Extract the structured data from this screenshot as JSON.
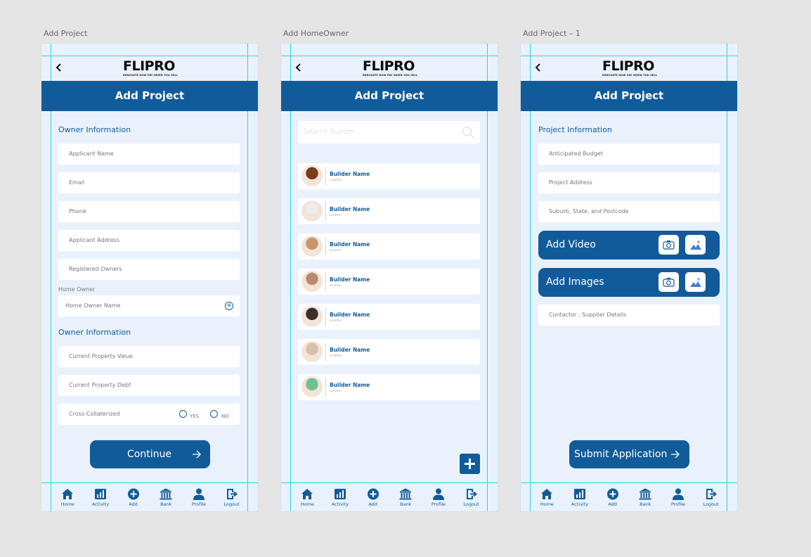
{
  "screens": [
    {
      "artboard_label": "Add Project",
      "logo": {
        "text": "FLIPRO",
        "tagline": "RENOVATE NOW PAY WHEN YOU SELL"
      },
      "header": {
        "title": "Add Project"
      },
      "sections": {
        "owner_info_1": "Owner Information",
        "home_owner_label": "Home Owner",
        "owner_info_2": "Owner Information"
      },
      "fields": {
        "applicant_name": "Applicant Name",
        "email": "Email",
        "phone": "Phone",
        "applicant_address": "Applicant Address",
        "registered_owners": "Registered Owners",
        "home_owner_name": "Home Owner Name",
        "current_property_value": "Current Property Value",
        "current_property_debt": "Current Property Debt",
        "cross_collateralized": "Cross-Collaterized"
      },
      "radio": {
        "yes": "YES",
        "no": "NO"
      },
      "continue_button": "Continue"
    },
    {
      "artboard_label": "Add HomeOwner",
      "logo": {
        "text": "FLIPRO",
        "tagline": "RENOVATE NOW PAY WHEN YOU SELL"
      },
      "header": {
        "title": "Add Project"
      },
      "search": {
        "placeholder": "Search Builder"
      },
      "builders": [
        {
          "name": "Builder Name",
          "location": "Location",
          "avatar_color": "#7a3b1e"
        },
        {
          "name": "Builder Name",
          "location": "Location",
          "avatar_color": "#ececec"
        },
        {
          "name": "Builder Name",
          "location": "Location",
          "avatar_color": "#c8956f"
        },
        {
          "name": "Builder Name",
          "location": "Location",
          "avatar_color": "#b98a6c"
        },
        {
          "name": "Builder Name",
          "location": "Location",
          "avatar_color": "#3a2f2b"
        },
        {
          "name": "Builder Name",
          "location": "Location",
          "avatar_color": "#d8c0aa"
        },
        {
          "name": "Builder Name",
          "location": "Location",
          "avatar_color": "#6fc28e"
        }
      ]
    },
    {
      "artboard_label": "Add Project – 1",
      "logo": {
        "text": "FLIPRO",
        "tagline": "RENOVATE NOW PAY WHEN YOU SELL"
      },
      "header": {
        "title": "Add Project"
      },
      "section_title": "Project Information",
      "fields": {
        "anticipated_budget": "Anticipated Budget",
        "project_address": "Project Address",
        "suburb": "Suburb, State, and Postcode",
        "contractor": "Contactor , Supplier Details"
      },
      "add_video": "Add Video",
      "add_images": "Add Images",
      "submit_button": "Submit Application"
    }
  ],
  "nav": [
    {
      "label": "Home",
      "icon": "home-icon"
    },
    {
      "label": "Activity",
      "icon": "activity-icon"
    },
    {
      "label": "Add",
      "icon": "add-icon"
    },
    {
      "label": "Bank",
      "icon": "bank-icon"
    },
    {
      "label": "Profile",
      "icon": "profile-icon"
    },
    {
      "label": "Logout",
      "icon": "logout-icon"
    }
  ],
  "colors": {
    "primary": "#125b9a",
    "screen_bg": "#e9f2fc",
    "canvas_bg": "#e5e5e5",
    "guide": "#24d6e6"
  }
}
